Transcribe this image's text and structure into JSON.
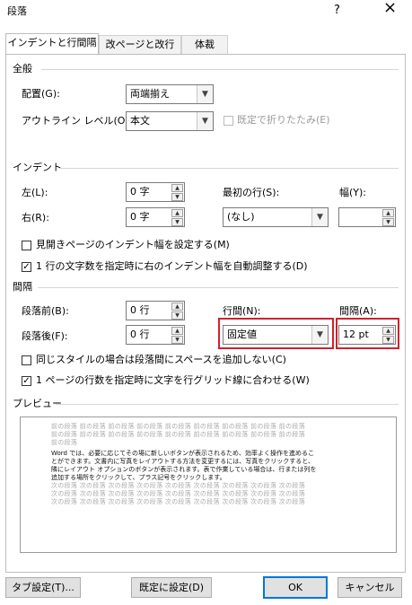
{
  "window": {
    "title": "段落",
    "help_icon": "?",
    "close_icon": "×"
  },
  "tabs": [
    {
      "label": "インデントと行間隔",
      "active": true
    },
    {
      "label": "改ページと改行",
      "active": false
    },
    {
      "label": "体裁",
      "active": false
    }
  ],
  "general": {
    "title": "全般",
    "alignment_label": "配置(G):",
    "alignment_value": "両端揃え",
    "outline_label": "アウトライン レベル(O):",
    "outline_value": "本文",
    "collapsed_label": "既定で折りたたみ(E)"
  },
  "indent": {
    "title": "インデント",
    "left_label": "左(L):",
    "left_value": "0 字",
    "right_label": "右(R):",
    "right_value": "0 字",
    "first_line_label": "最初の行(S):",
    "first_line_value": "(なし)",
    "width_label": "幅(Y):",
    "width_value": "",
    "mirror_label": "見開きページのインデント幅を設定する(M)",
    "mirror_checked": false,
    "auto_adjust_label": "1 行の文字数を指定時に右のインデント幅を自動調整する(D)",
    "auto_adjust_checked": true
  },
  "spacing": {
    "title": "間隔",
    "before_label": "段落前(B):",
    "before_value": "0 行",
    "after_label": "段落後(F):",
    "after_value": "0 行",
    "line_spacing_label": "行間(N):",
    "line_spacing_value": "固定値",
    "at_label": "間隔(A):",
    "at_value": "12 pt",
    "dont_add_label": "同じスタイルの場合は段落間にスペースを追加しない(C)",
    "dont_add_checked": false,
    "snap_grid_label": "1 ページの行数を指定時に文字を行グリッド線に合わせる(W)",
    "snap_grid_checked": true
  },
  "preview": {
    "title": "プレビュー",
    "prev_lines": [
      "前の段落 前の段落 前の段落 前の段落 前の段落 前の段落 前の段落 前の段落 前の段落",
      "前の段落 前の段落 前の段落 前の段落 前の段落 前の段落 前の段落 前の段落 前の段落",
      "前の段落"
    ],
    "main_lines": [
      "Word では、必要に応じてその場に新しいボタンが表示されるため、効率よく操作を進めるこ",
      "とができます。文書内に写真をレイアウトする方法を変更するには、写真をクリックすると、",
      "隣にレイアウト オプションのボタンが表示されます。表で作業している場合は、行または列を",
      "追加する場所をクリックして、プラス記号をクリックします。"
    ],
    "next_lines": [
      "次の段落 次の段落 次の段落 次の段落 次の段落 次の段落 次の段落 次の段落 次の段落",
      "次の段落 次の段落 次の段落 次の段落 次の段落 次の段落 次の段落 次の段落 次の段落",
      "次の段落 次の段落 次の段落 次の段落 次の段落 次の段落 次の段落 次の段落 次の段落"
    ]
  },
  "buttons": {
    "tabs": "タブ設定(T)...",
    "set_default": "既定に設定(D)",
    "ok": "OK",
    "cancel": "キャンセル"
  },
  "colors": {
    "highlight": "#d1202f",
    "ok_border": "#0078d7"
  }
}
